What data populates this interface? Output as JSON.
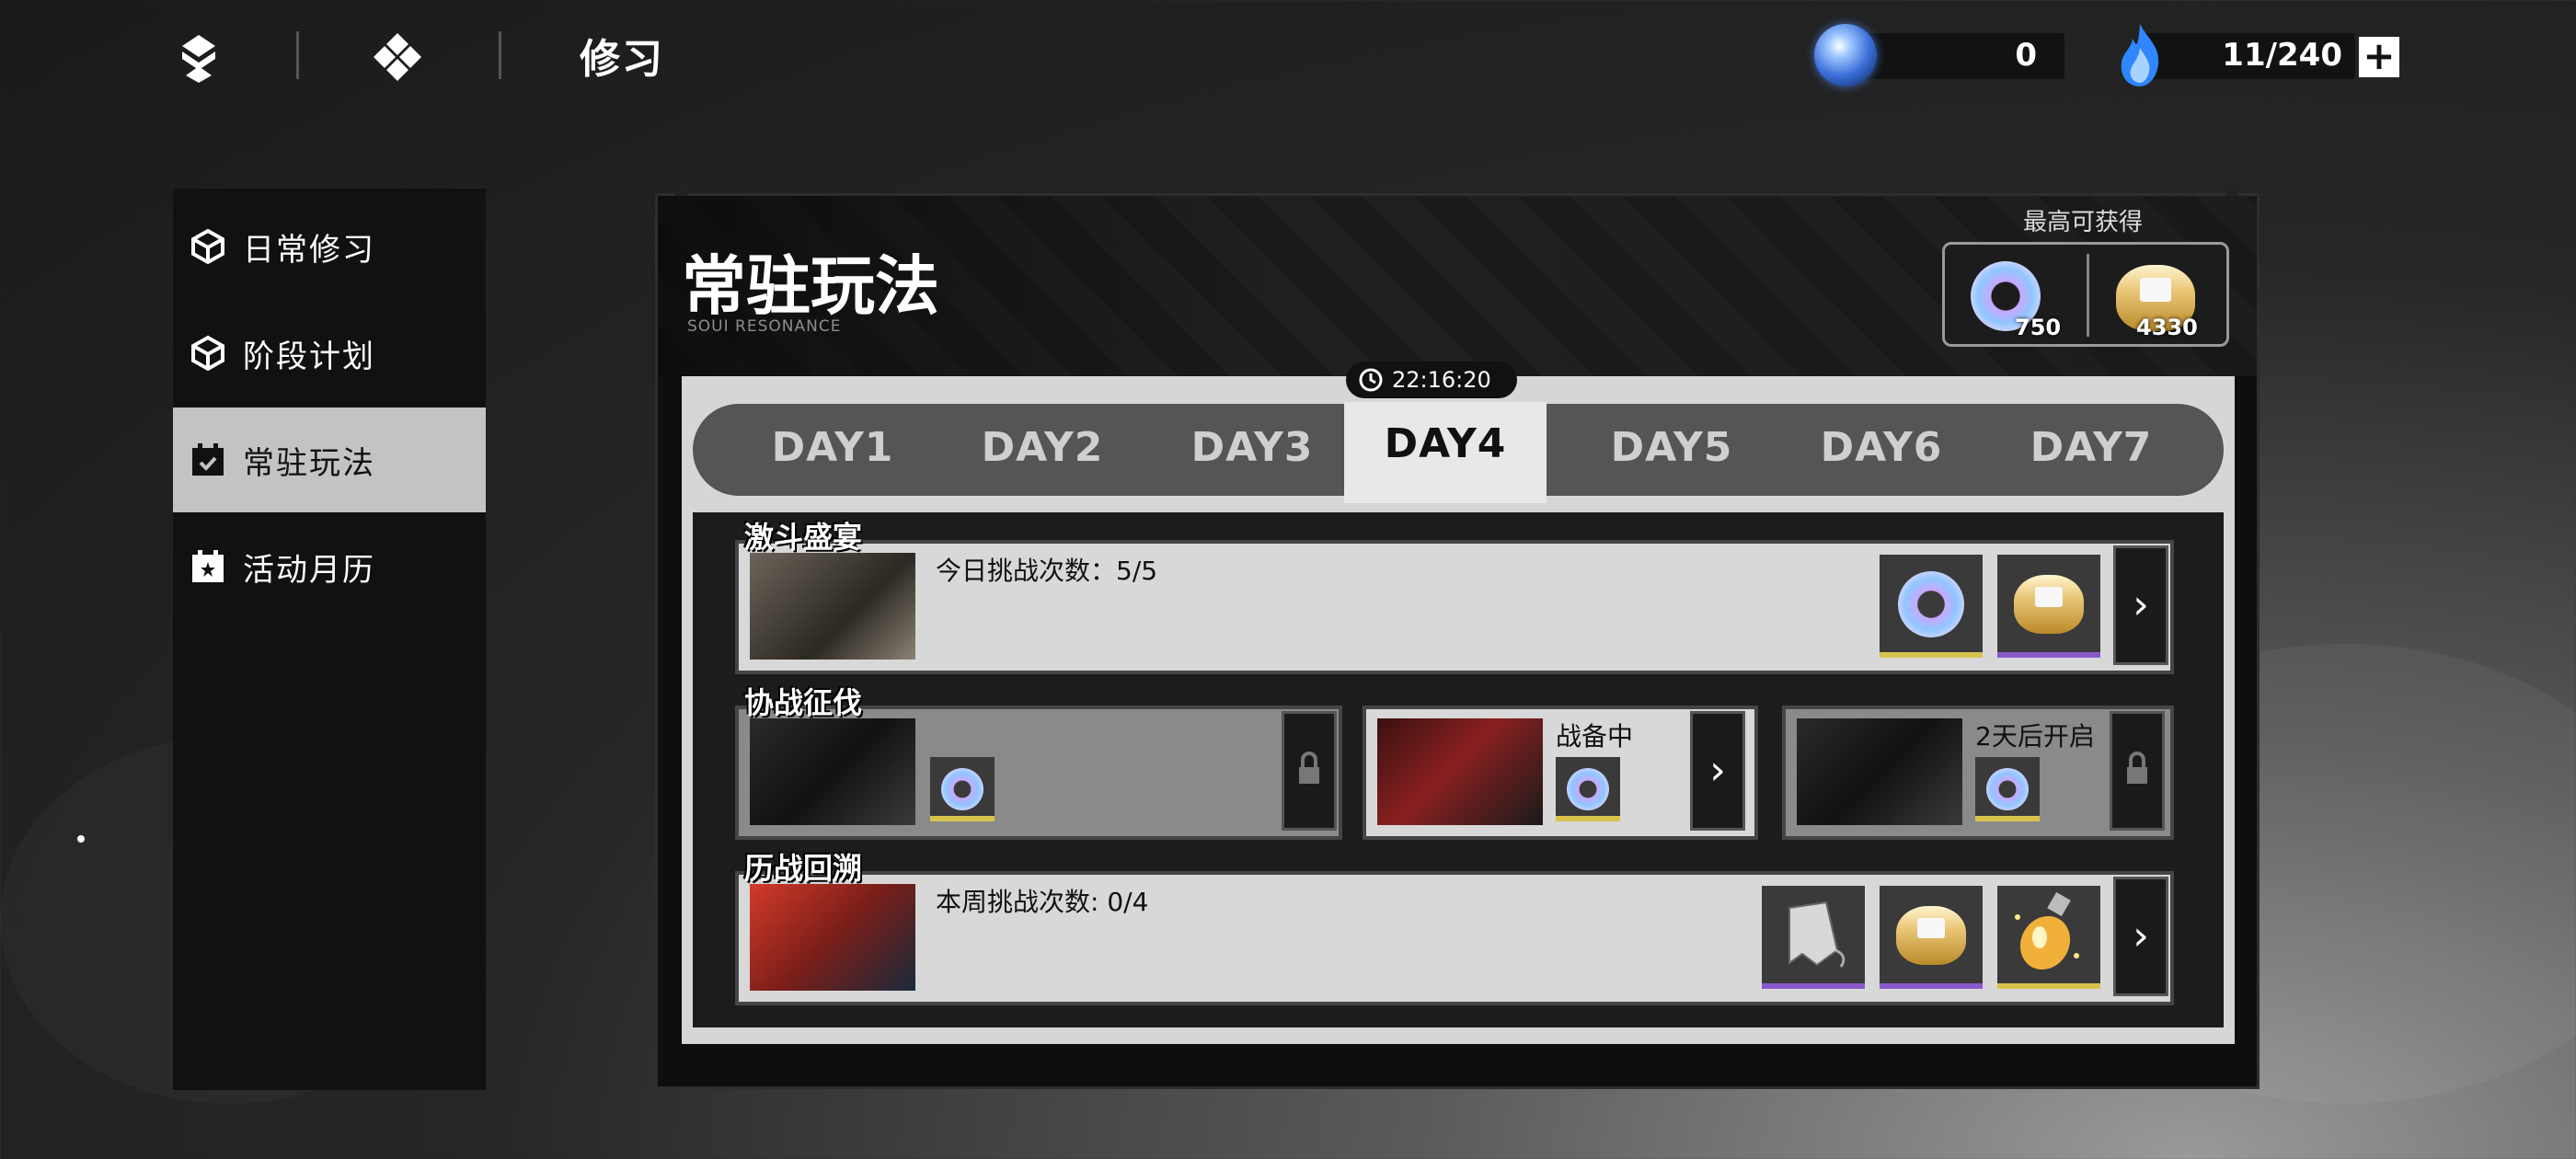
{
  "topbar": {
    "title": "修习",
    "currencies": [
      {
        "icon": "blue-orb-icon",
        "value": "0"
      },
      {
        "icon": "blue-flame-icon",
        "value": "11/240"
      }
    ],
    "add_label": "+"
  },
  "sidebar": {
    "items": [
      {
        "label": "日常修习",
        "icon": "cube-icon",
        "active": false
      },
      {
        "label": "阶段计划",
        "icon": "cube-icon",
        "active": false
      },
      {
        "label": "常驻玩法",
        "icon": "calendar-icon",
        "active": true
      },
      {
        "label": "活动月历",
        "icon": "calendar-star-icon",
        "active": false
      }
    ]
  },
  "panel": {
    "title": "常驻玩法",
    "subtitle": "SOUI RESONANCE",
    "max_label": "最高可获得",
    "max_rewards": [
      {
        "icon": "ring-icon",
        "qty": "750"
      },
      {
        "icon": "gold-ingot-icon",
        "qty": "4330"
      }
    ],
    "timer": "22:16:20",
    "tabs": [
      "DAY1",
      "DAY2",
      "DAY3",
      "DAY4",
      "DAY5",
      "DAY6",
      "DAY7"
    ],
    "active_tab": "DAY4",
    "rows": [
      {
        "title": "激斗盛宴",
        "cards": [
          {
            "info": "今日挑战次数：5/5",
            "state": "open"
          }
        ]
      },
      {
        "title": "协战征伐",
        "cards": [
          {
            "info": "",
            "state": "locked"
          },
          {
            "info": "战备中",
            "state": "open"
          },
          {
            "info": "2天后开启",
            "state": "locked"
          }
        ]
      },
      {
        "title": "历战回溯",
        "cards": [
          {
            "info": "本周挑战次数: 0/4",
            "state": "open"
          }
        ]
      }
    ]
  },
  "colors": {
    "accent_gold": "#d8c24c",
    "accent_purple": "#8a5acb",
    "sidebar_active": "#c3c3c3"
  }
}
